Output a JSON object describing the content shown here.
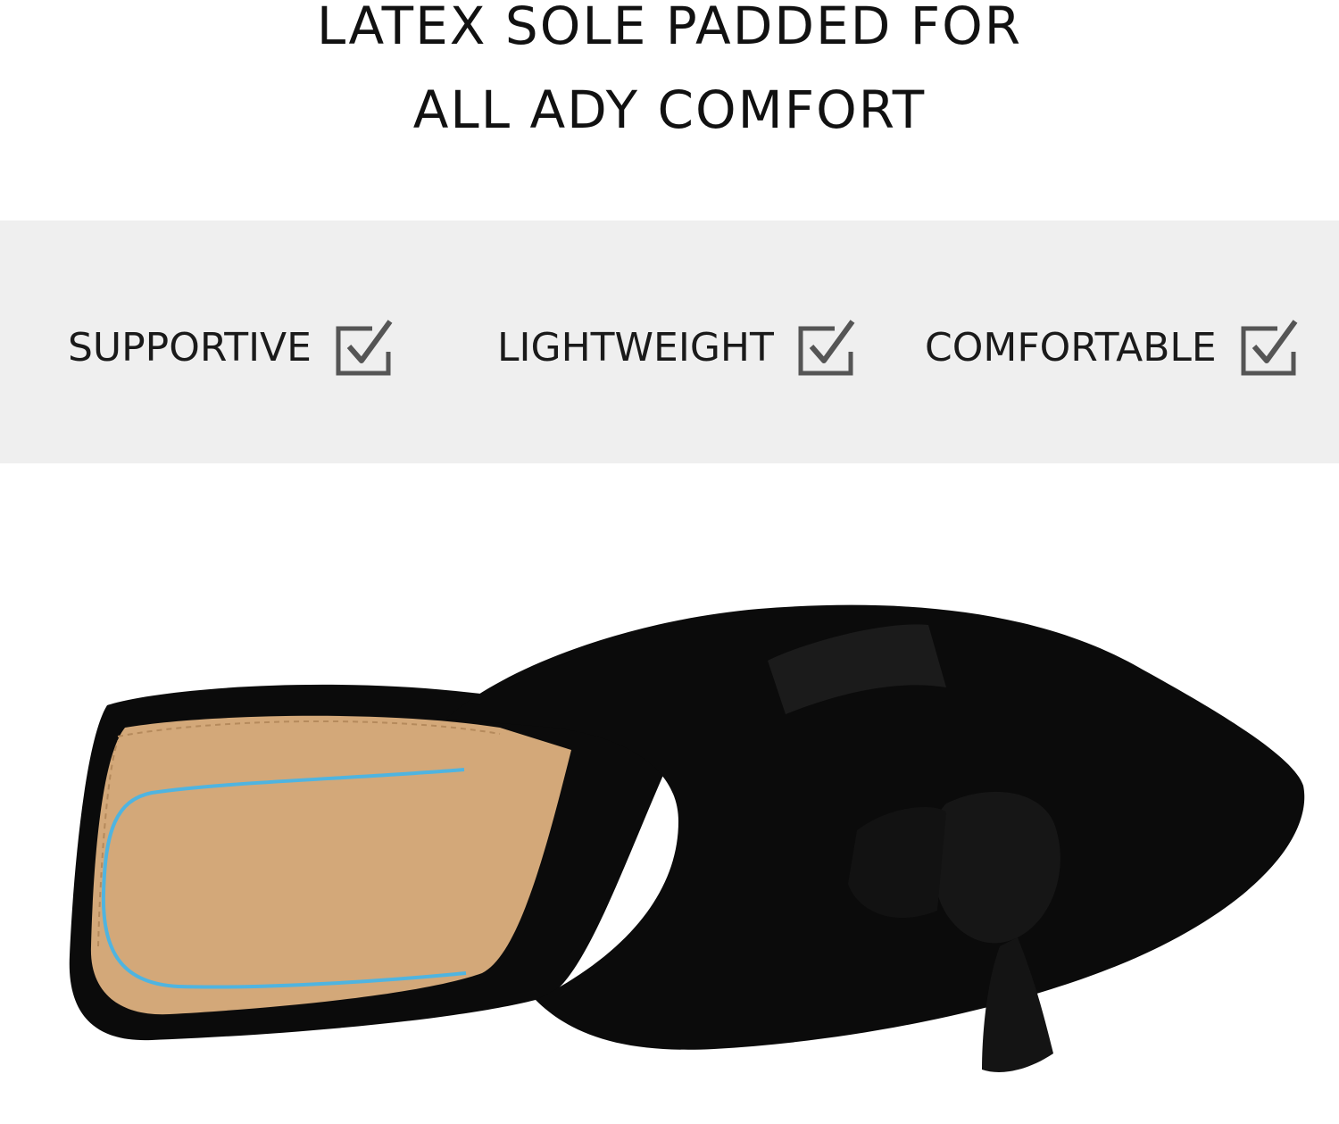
{
  "headline": {
    "line1": "LATEX SOLE PADDED FOR",
    "line2": "ALL ADY COMFORT"
  },
  "features": [
    {
      "label": "SUPPORTIVE",
      "icon": "checkbox-checked-icon"
    },
    {
      "label": "LIGHTWEIGHT",
      "icon": "checkbox-checked-icon"
    },
    {
      "label": "COMFORTABLE",
      "icon": "checkbox-checked-icon"
    }
  ],
  "colors": {
    "band": "#efefef",
    "text": "#111111",
    "icon": "#555555",
    "shoe": "#0b0b0b",
    "insole": "#d3a879",
    "arch_line": "#4fb4e0"
  },
  "product": {
    "image": "black-suede-bow-mule-icon"
  }
}
